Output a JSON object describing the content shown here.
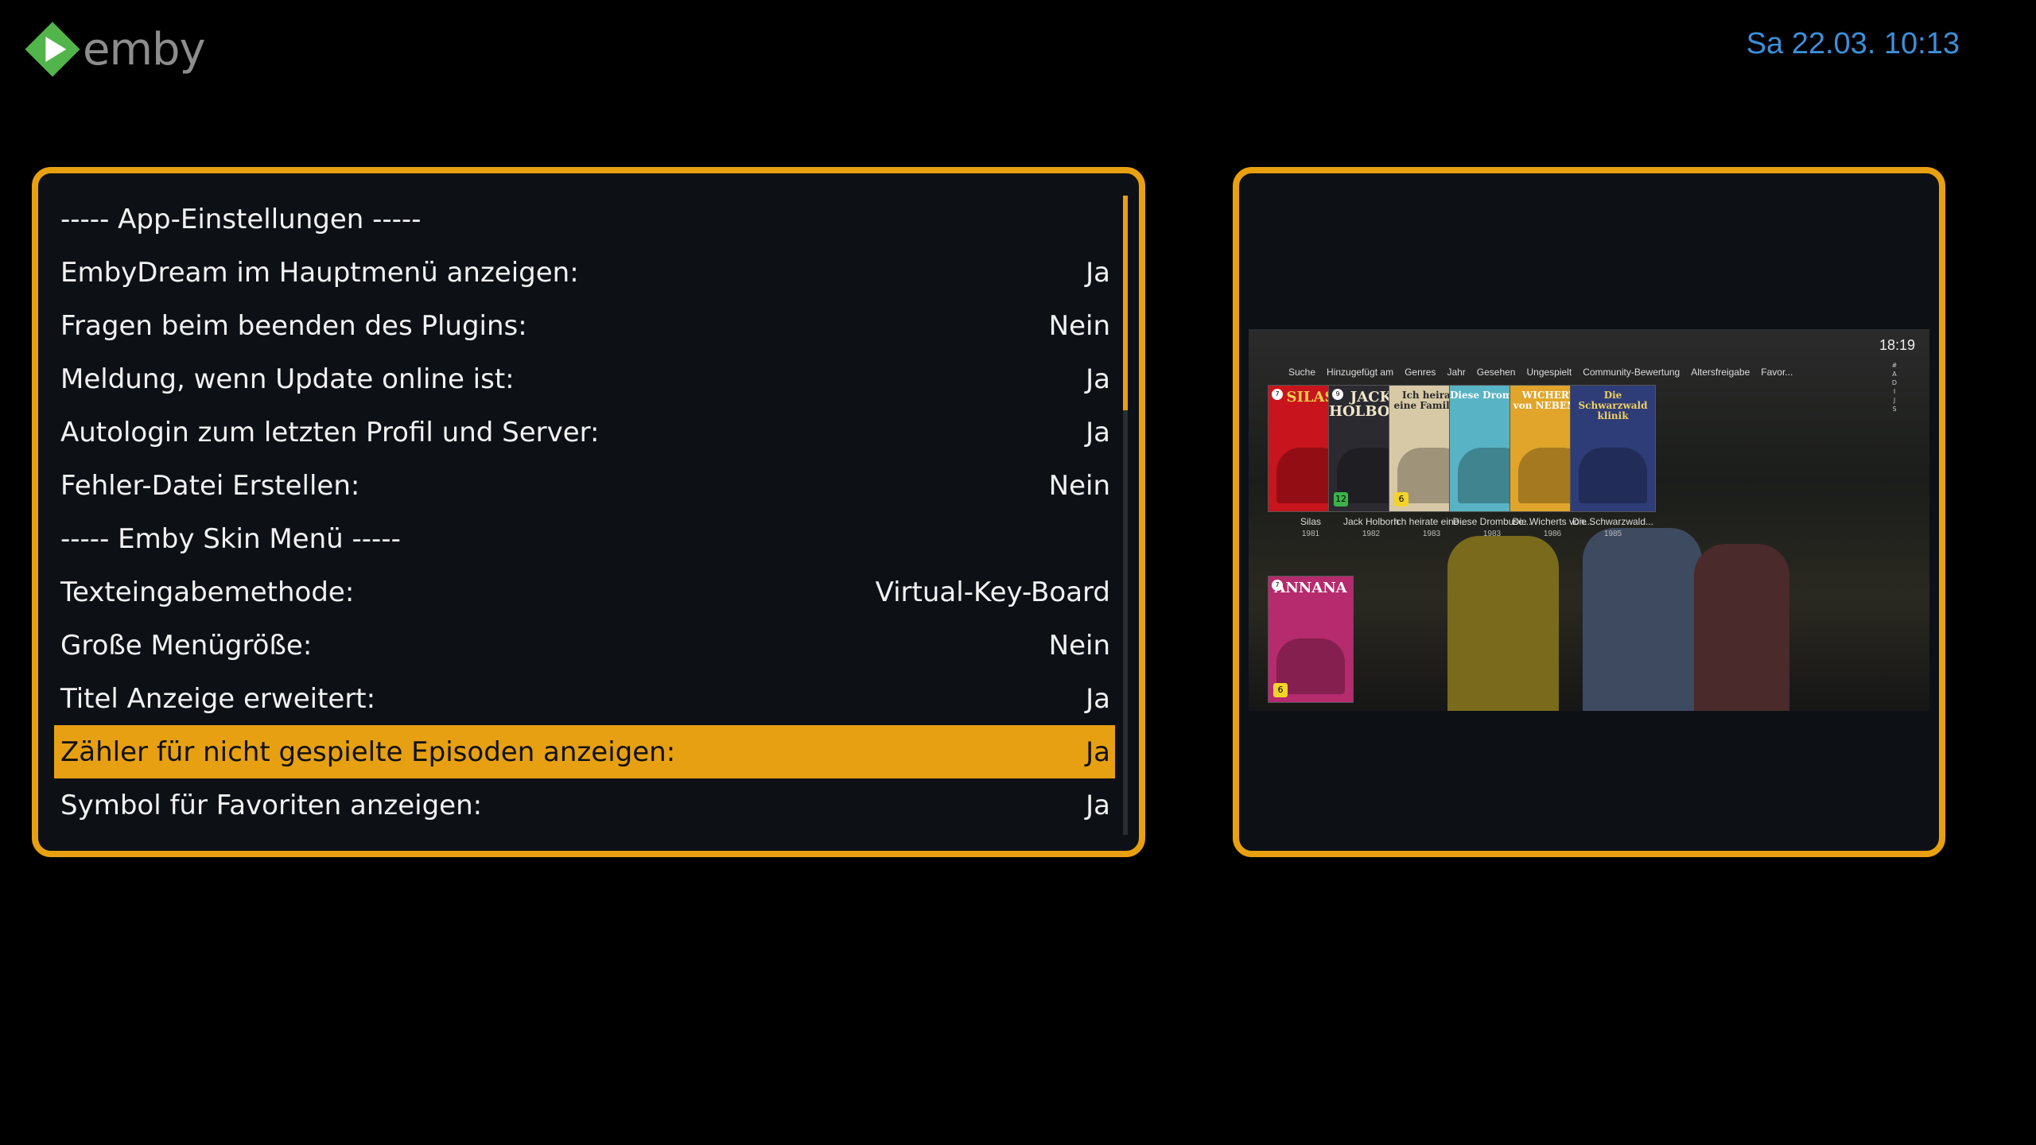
{
  "app": {
    "logo_text": "emby"
  },
  "header": {
    "datetime": "Sa 22.03.  10:13"
  },
  "colors": {
    "accent": "#e8a010",
    "datetime": "#3c8fd8",
    "panel_bg": "#0d1116"
  },
  "settings": {
    "rows": [
      {
        "label": "----- App-Einstellungen -----",
        "value": ""
      },
      {
        "label": "EmbyDream im Hauptmenü anzeigen:",
        "value": "Ja"
      },
      {
        "label": "Fragen beim beenden des Plugins:",
        "value": "Nein"
      },
      {
        "label": "Meldung, wenn Update online ist:",
        "value": "Ja"
      },
      {
        "label": "Autologin zum letzten Profil und Server:",
        "value": "Ja"
      },
      {
        "label": "Fehler-Datei Erstellen:",
        "value": "Nein"
      },
      {
        "label": "----- Emby Skin Menü -----",
        "value": ""
      },
      {
        "label": "Texteingabemethode:",
        "value": "Virtual-Key-Board"
      },
      {
        "label": "Große Menügröße:",
        "value": "Nein"
      },
      {
        "label": "Titel Anzeige erweitert:",
        "value": "Ja"
      },
      {
        "label": "Zähler für nicht gespielte Episoden anzeigen:",
        "value": "Ja"
      },
      {
        "label": "Symbol für Favoriten anzeigen:",
        "value": "Ja"
      }
    ],
    "selected_index": 10
  },
  "preview": {
    "time": "18:19",
    "nav": [
      "Suche",
      "Hinzugefügt am",
      "Genres",
      "Jahr",
      "Gesehen",
      "Ungespielt",
      "Community-Bewertung",
      "Altersfreigabe",
      "Favor..."
    ],
    "alpha_index": "#\nA\nD\nI\nJ\nS",
    "posters": [
      {
        "caption": "Silas",
        "year": "1981",
        "poster_text": "SILAS",
        "badge": "7",
        "fsk": "",
        "bg": "#c8141c",
        "fg": "#f1d14a"
      },
      {
        "caption": "Jack Holborn",
        "year": "1982",
        "poster_text": "JACK\nHOLBORN",
        "badge": "9",
        "fsk": "12",
        "bg": "#2a2a30",
        "fg": "#f0e6c8"
      },
      {
        "caption": "Ich heirate eine ...",
        "year": "1983",
        "poster_text": "Ich heirate\neine Familie...",
        "badge": "",
        "fsk": "6",
        "bg": "#d8c9a6",
        "fg": "#2a2a2a"
      },
      {
        "caption": "Diese Drombusc...",
        "year": "1983",
        "poster_text": "Diese Drombuschs",
        "badge": "",
        "fsk": "",
        "bg": "#58b4c4",
        "fg": "#ffffff"
      },
      {
        "caption": "Die Wicherts von...",
        "year": "1986",
        "poster_text": "WICHERTS\nvon NEBENAN",
        "badge": "",
        "fsk": "",
        "bg": "#e0a52a",
        "fg": "#ffffff"
      },
      {
        "caption": "Die Schwarzwald...",
        "year": "1985",
        "poster_text": "Die\nSchwarzwald\nklinik",
        "badge": "",
        "fsk": "",
        "bg": "#2e3d78",
        "fg": "#f0d060"
      },
      {
        "caption": "",
        "year": "",
        "poster_text": "ANNANA",
        "badge": "7",
        "fsk": "6",
        "bg": "#b52b6d",
        "fg": "#ffffff"
      }
    ]
  }
}
